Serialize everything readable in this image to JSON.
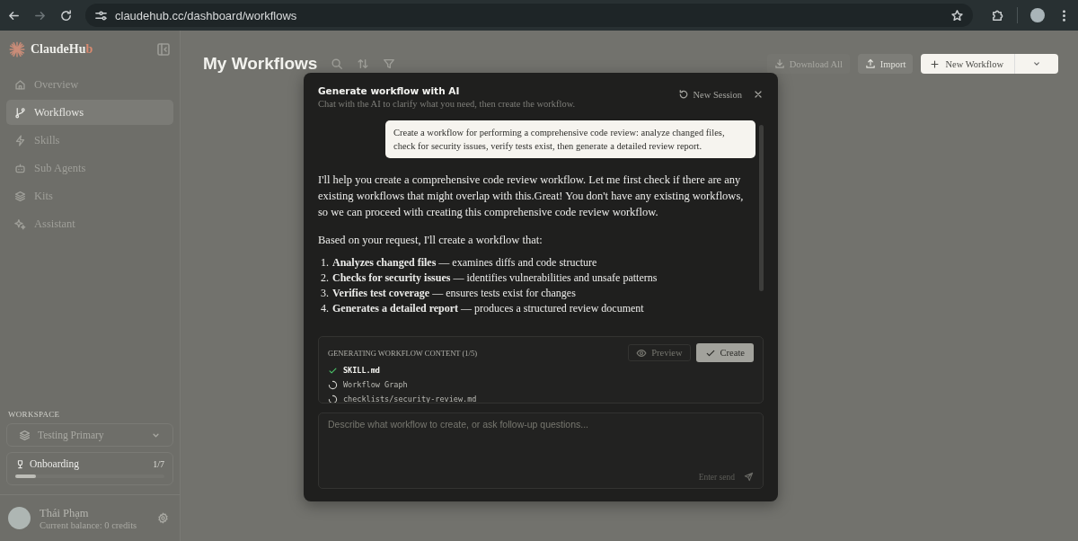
{
  "browser": {
    "url": "claudehub.cc/dashboard/workflows"
  },
  "sidebar": {
    "brand_main": "ClaudeHu",
    "brand_accent": "b",
    "items": [
      {
        "label": "Overview",
        "selected": false
      },
      {
        "label": "Workflows",
        "selected": true
      },
      {
        "label": "Skills",
        "selected": false
      },
      {
        "label": "Sub Agents",
        "selected": false
      },
      {
        "label": "Kits",
        "selected": false
      },
      {
        "label": "Assistant",
        "selected": false
      }
    ],
    "workspace_label": "WORKSPACE",
    "workspace": "Testing Primary",
    "onboarding": {
      "title": "Onboarding",
      "count": "1/7",
      "level": 0.14
    },
    "user": {
      "name": "Thái Phạm",
      "balance": "Current balance: 0 credits"
    }
  },
  "page": {
    "title": "My Workflows",
    "actions": [
      {
        "label": "Download All",
        "disabled": true
      },
      {
        "label": "Import",
        "disabled": false
      }
    ],
    "primary": "New Workflow"
  },
  "dialog": {
    "title": "Generate workflow with AI",
    "subtitle": "Chat with the AI to clarify what you need, then create the workflow.",
    "new_session": "New Session",
    "user_message": "Create a workflow for performing a comprehensive code review: analyze changed files, check for security issues, verify tests exist, then generate a detailed review report.",
    "reply": [
      "I'll help you create a comprehensive code review workflow. Let me first check if there are any existing workflows that might overlap with this.Great! You don't have any existing workflows, so we can proceed with creating this comprehensive code review workflow.",
      "Based on your request, I'll create a workflow that:"
    ],
    "steps": [
      {
        "number": "1.",
        "text": "**Analyzes changed files** — examines diffs and code structure"
      },
      {
        "number": "2.",
        "text": "**Checks for security issues** — identifies vulnerabilities and unsafe patterns"
      },
      {
        "number": "3.",
        "text": "**Verifies test coverage** — ensures tests exist for changes"
      },
      {
        "number": "4.",
        "text": "**Generates a detailed report** — produces a structured review document"
      }
    ],
    "progress": {
      "title": "GENERATING WORKFLOW CONTENT (1/5)",
      "preview": "Preview",
      "create": "Create",
      "files": [
        {
          "name": "SKILL.md",
          "done": true
        },
        {
          "name": "Workflow Graph",
          "done": false
        },
        {
          "name": "checklists/security-review.md",
          "done": false
        }
      ]
    },
    "composer": {
      "placeholder": "Describe what workflow to create, or ask follow-up questions...",
      "hint": "Enter send"
    }
  }
}
